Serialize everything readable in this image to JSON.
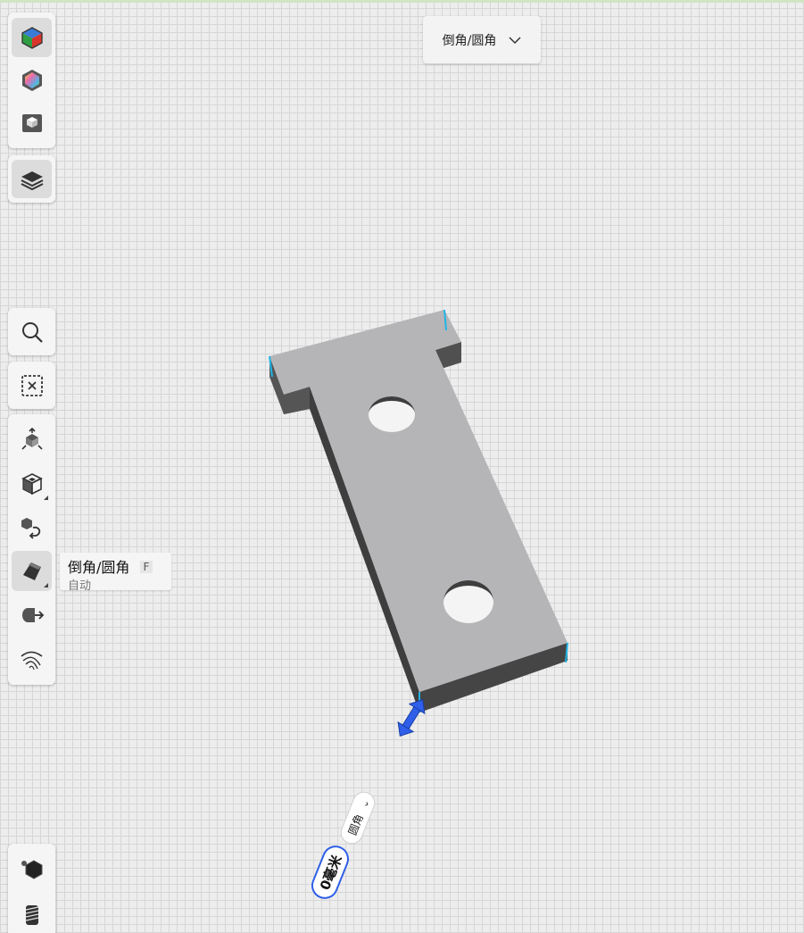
{
  "top_dropdown": {
    "label": "倒角/圆角",
    "icon": "chevron-down-icon"
  },
  "tooltip": {
    "title": "倒角/圆角",
    "shortcut": "F",
    "subtitle": "自动"
  },
  "toolbar_top": [
    {
      "icon": "appearance-cube-icon"
    },
    {
      "icon": "color-hexagon-icon"
    },
    {
      "icon": "render-box-icon"
    }
  ],
  "layers_button": {
    "icon": "layers-icon"
  },
  "tools": [
    {
      "icon": "search-icon"
    },
    {
      "icon": "deselect-icon"
    },
    {
      "icon": "move-transform-icon"
    },
    {
      "icon": "view-cube-icon"
    },
    {
      "icon": "rotate-copy-icon"
    },
    {
      "icon": "fillet-chamfer-icon"
    },
    {
      "icon": "export-roll-icon"
    },
    {
      "icon": "sweep-surface-icon"
    }
  ],
  "bottom_tools": [
    {
      "icon": "solid-hexagon-icon"
    },
    {
      "icon": "thread-icon"
    }
  ],
  "fillet_chip": {
    "type_label": "圆角",
    "value": "0毫米"
  },
  "colors": {
    "accent": "#2f5fe8",
    "edge_highlight": "#1fb5e6",
    "part_top": "#b5b5b8",
    "part_side": "#4a4a4a"
  }
}
